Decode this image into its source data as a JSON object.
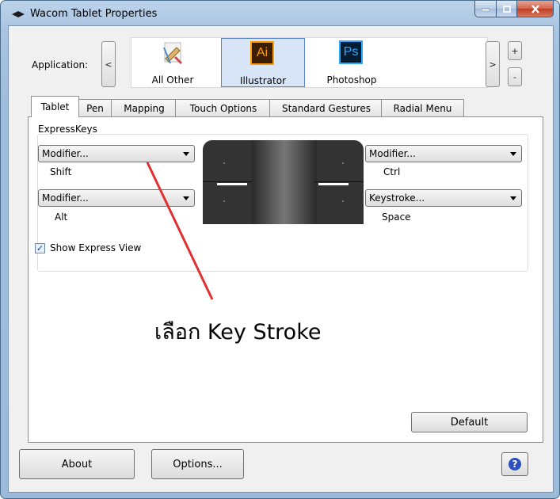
{
  "window": {
    "title": "Wacom Tablet Properties",
    "title_icon": "wacom-pen-icon",
    "caption_buttons": {
      "minimize": "minimize-icon",
      "maximize": "maximize-icon",
      "close": "close-icon"
    }
  },
  "application": {
    "label": "Application:",
    "scroll_left": "<",
    "scroll_right": ">",
    "add": "+",
    "remove": "-",
    "items": [
      {
        "label": "All Other",
        "icon": "all-other-apps-icon",
        "selected": false
      },
      {
        "label": "Illustrator",
        "icon": "illustrator-icon",
        "icon_text": "Ai",
        "selected": true
      },
      {
        "label": "Photoshop",
        "icon": "photoshop-icon",
        "icon_text": "Ps",
        "selected": false
      }
    ]
  },
  "tabs": [
    {
      "label": "Tablet",
      "active": true
    },
    {
      "label": "Pen",
      "active": false
    },
    {
      "label": "Mapping",
      "active": false
    },
    {
      "label": "Touch Options",
      "active": false
    },
    {
      "label": "Standard Gestures",
      "active": false
    },
    {
      "label": "Radial Menu",
      "active": false
    }
  ],
  "expresskeys": {
    "group_title": "ExpressKeys",
    "left_top": {
      "value": "Modifier...",
      "sub": "Shift"
    },
    "left_bottom": {
      "value": "Modifier...",
      "sub": "Alt"
    },
    "right_top": {
      "value": "Modifier...",
      "sub": "Ctrl"
    },
    "right_bottom": {
      "value": "Keystroke...",
      "sub": "Space"
    },
    "show_express_view": {
      "label": "Show Express View",
      "checked": true
    }
  },
  "annotation": {
    "text": "เลือก Key Stroke",
    "color": "#e03030"
  },
  "buttons": {
    "default": "Default",
    "about": "About",
    "options": "Options..."
  },
  "help": {
    "icon": "help-icon",
    "symbol": "?"
  }
}
